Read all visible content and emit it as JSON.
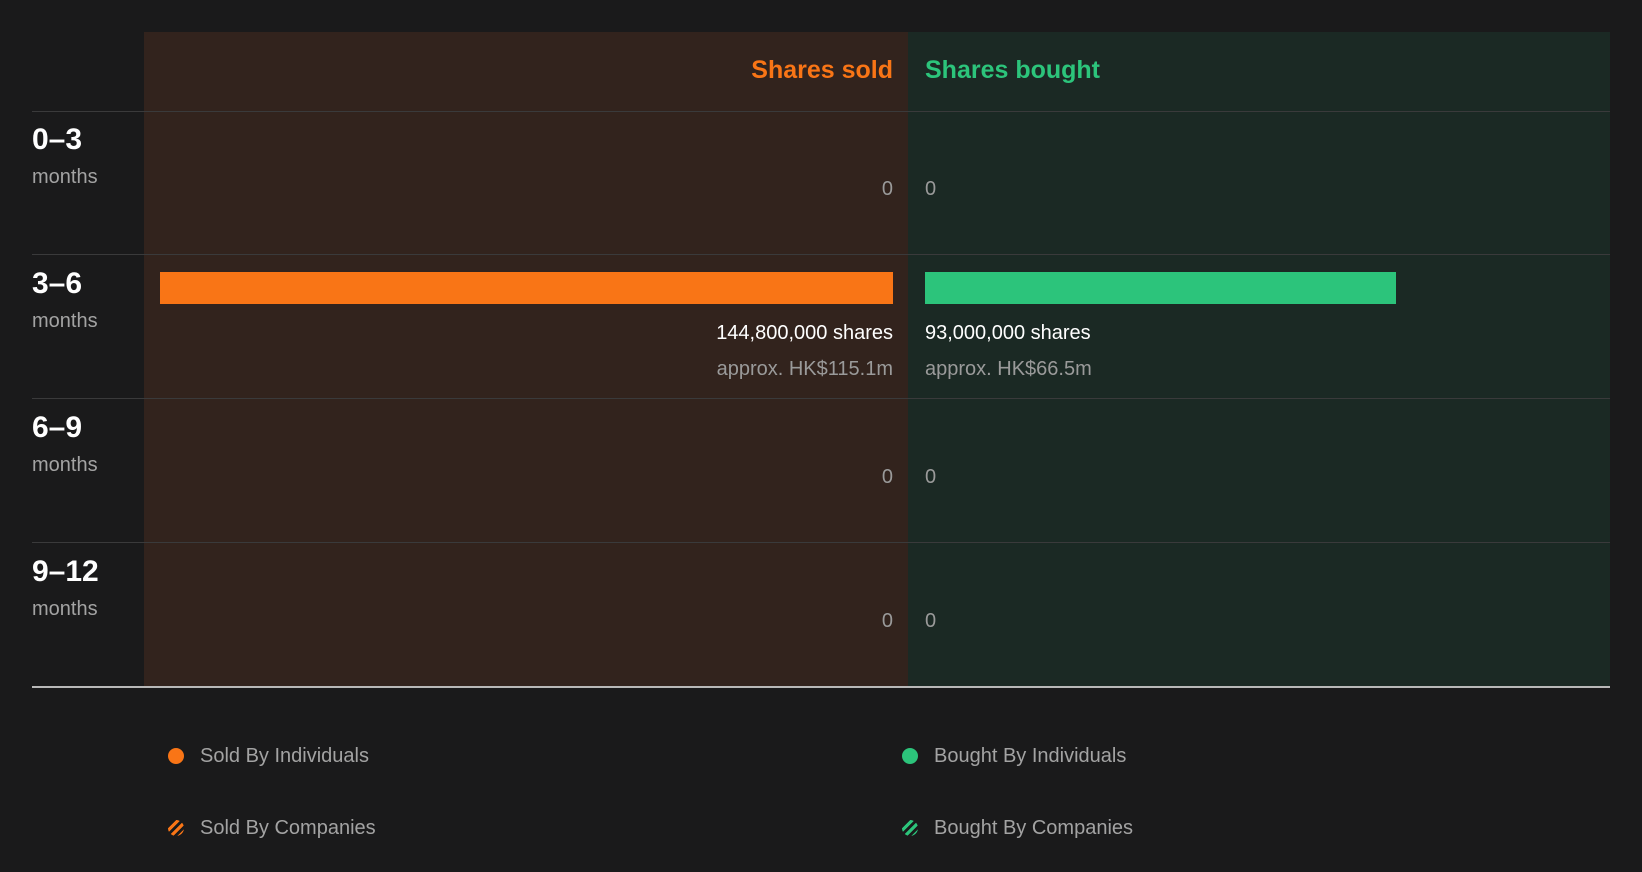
{
  "colors": {
    "sold": "#f97516",
    "bought": "#2cc47b",
    "sold_bg": "#32231d",
    "bought_bg": "#1b2924",
    "page_bg": "#1a1a1b"
  },
  "headers": {
    "sold": "Shares sold",
    "bought": "Shares bought"
  },
  "chart_data": {
    "type": "bar",
    "orientation": "horizontal-diverging",
    "categories": [
      "0–3 months",
      "3–6 months",
      "6–9 months",
      "9–12 months"
    ],
    "series": [
      {
        "name": "Shares sold",
        "values": [
          0,
          144800000,
          0,
          0
        ],
        "value_labels": [
          "0",
          "144,800,000 shares",
          "0",
          "0"
        ],
        "approx_labels": [
          "",
          "approx. HK$115.1m",
          "",
          ""
        ]
      },
      {
        "name": "Shares bought",
        "values": [
          0,
          93000000,
          0,
          0
        ],
        "value_labels": [
          "0",
          "93,000,000 shares",
          "0",
          "0"
        ],
        "approx_labels": [
          "",
          "approx. HK$66.5m",
          "",
          ""
        ]
      }
    ],
    "max_value": 144800000,
    "legend": [
      {
        "label": "Sold By Individuals",
        "style": "solid",
        "color": "#f97516"
      },
      {
        "label": "Bought By Individuals",
        "style": "solid",
        "color": "#2cc47b"
      },
      {
        "label": "Sold By Companies",
        "style": "striped",
        "color": "#f97516"
      },
      {
        "label": "Bought By Companies",
        "style": "striped",
        "color": "#2cc47b"
      }
    ]
  },
  "rows": [
    {
      "range": "0–3",
      "unit": "months"
    },
    {
      "range": "3–6",
      "unit": "months"
    },
    {
      "range": "6–9",
      "unit": "months"
    },
    {
      "range": "9–12",
      "unit": "months"
    }
  ]
}
